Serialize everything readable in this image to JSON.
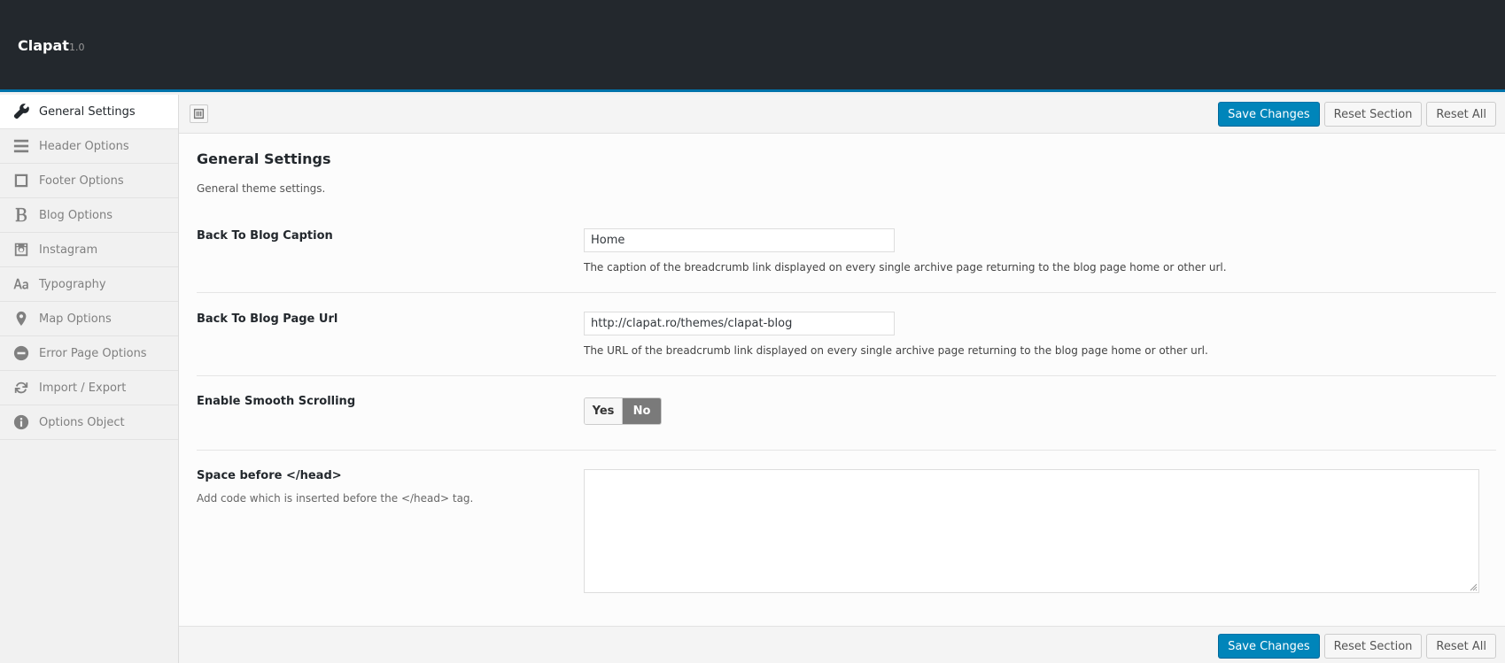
{
  "header": {
    "title": "Clapat",
    "version": "1.0"
  },
  "sidebar": {
    "items": [
      {
        "label": "General Settings",
        "icon": "wrench-icon",
        "active": true
      },
      {
        "label": "Header Options",
        "icon": "menu-lines-icon"
      },
      {
        "label": "Footer Options",
        "icon": "square-icon"
      },
      {
        "label": "Blog Options",
        "icon": "bold-b-icon"
      },
      {
        "label": "Instagram",
        "icon": "instagram-icon"
      },
      {
        "label": "Typography",
        "icon": "typography-icon"
      },
      {
        "label": "Map Options",
        "icon": "map-pin-icon"
      },
      {
        "label": "Error Page Options",
        "icon": "minus-circle-icon"
      },
      {
        "label": "Import / Export",
        "icon": "refresh-icon"
      },
      {
        "label": "Options Object",
        "icon": "info-icon"
      }
    ]
  },
  "toolbar": {
    "save_label": "Save Changes",
    "reset_section_label": "Reset Section",
    "reset_all_label": "Reset All"
  },
  "section": {
    "title": "General Settings",
    "description": "General theme settings."
  },
  "fields": {
    "back_caption": {
      "label": "Back To Blog Caption",
      "value": "Home",
      "help": "The caption of the breadcrumb link displayed on every single archive page returning to the blog page home or other url."
    },
    "back_url": {
      "label": "Back To Blog Page Url",
      "value": "http://clapat.ro/themes/clapat-blog",
      "help": "The URL of the breadcrumb link displayed on every single archive page returning to the blog page home or other url."
    },
    "smooth_scroll": {
      "label": "Enable Smooth Scrolling",
      "yes": "Yes",
      "no": "No",
      "selected": "No"
    },
    "space_head": {
      "label": "Space before </head>",
      "sublabel": "Add code which is inserted before the </head> tag.",
      "value": ""
    }
  },
  "colors": {
    "accent": "#0073aa",
    "primary_button": "#0085ba",
    "topbar": "#23282d"
  }
}
